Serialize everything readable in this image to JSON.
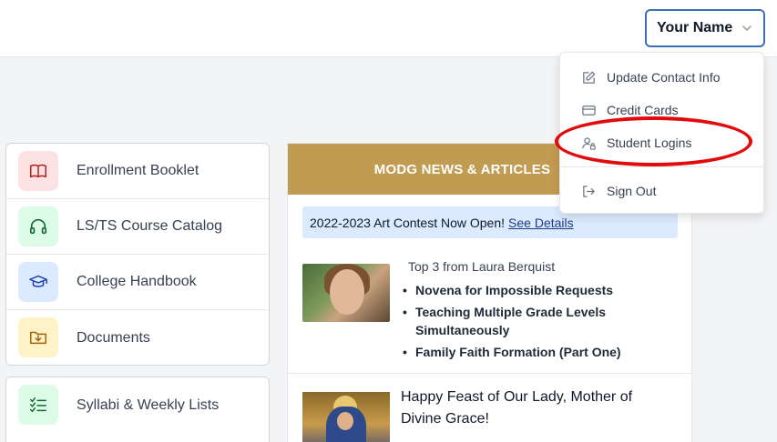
{
  "header": {
    "user_name": "Your Name"
  },
  "user_menu": {
    "items": [
      {
        "label": "Update Contact Info",
        "icon": "edit-icon"
      },
      {
        "label": "Credit Cards",
        "icon": "credit-card-icon"
      },
      {
        "label": "Student Logins",
        "icon": "user-lock-icon"
      },
      {
        "label": "Sign Out",
        "icon": "sign-out-icon"
      }
    ]
  },
  "sidebar": {
    "group1": [
      {
        "label": "Enrollment Booklet",
        "icon": "book-icon",
        "bg": "#fde2e4",
        "color": "#b91c1c"
      },
      {
        "label": "LS/TS Course Catalog",
        "icon": "headphones-icon",
        "bg": "#dcfce7",
        "color": "#166534"
      },
      {
        "label": "College Handbook",
        "icon": "graduation-cap-icon",
        "bg": "#dbeafe",
        "color": "#1e40af"
      },
      {
        "label": "Documents",
        "icon": "folder-download-icon",
        "bg": "#fef3c7",
        "color": "#a16207"
      }
    ],
    "group2": [
      {
        "label": "Syllabi & Weekly Lists",
        "icon": "checklist-icon",
        "bg": "#dcfce7",
        "color": "#166534"
      }
    ]
  },
  "news": {
    "title": "MODG NEWS & ARTICLES",
    "banner_text": "2022-2023 Art Contest Now Open!",
    "banner_link": "See Details",
    "top3_label": "Top 3 from Laura Berquist",
    "articles": [
      "Novena for Impossible Requests",
      "Teaching Multiple Grade Levels Simultaneously",
      "Family Faith Formation (Part One)"
    ],
    "feast_title": "Happy Feast of Our Lady, Mother of Divine Grace!"
  },
  "colors": {
    "accent_gold": "#c29b52",
    "highlight_red": "#e10b0b",
    "focus_blue": "#3b6fb6"
  }
}
